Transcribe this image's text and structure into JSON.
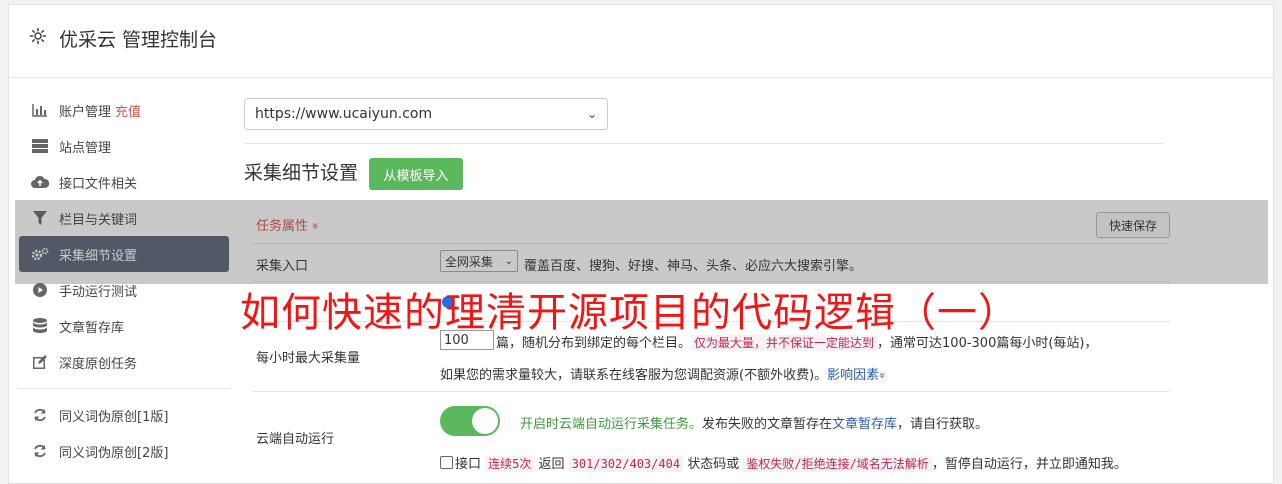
{
  "header": {
    "title": "优采云 管理控制台",
    "icon": "gear-icon"
  },
  "sidebar": {
    "items": [
      {
        "label": "账户管理",
        "badge": "充值",
        "icon": "bar-chart-icon"
      },
      {
        "label": "站点管理",
        "icon": "server-icon"
      },
      {
        "label": "接口文件相关",
        "icon": "cloud-upload-icon"
      },
      {
        "label": "栏目与关键词",
        "icon": "filter-icon"
      },
      {
        "label": "采集细节设置",
        "icon": "gears-icon",
        "active": true
      },
      {
        "label": "手动运行测试",
        "icon": "play-circle-icon"
      },
      {
        "label": "文章暂存库",
        "icon": "database-icon"
      },
      {
        "label": "深度原创任务",
        "icon": "edit-icon"
      },
      {
        "label": "同义词伪原创[1版]",
        "icon": "refresh-icon"
      },
      {
        "label": "同义词伪原创[2版]",
        "icon": "refresh-icon"
      }
    ]
  },
  "main": {
    "site_url": "https://www.ucaiyun.com",
    "section_title": "采集细节设置",
    "import_button": "从模板导入",
    "task_attr": "任务属性",
    "task_attr_chevron": "»",
    "quick_save": "快速保存",
    "collect_entry": {
      "label": "采集入口",
      "select_value": "全网采集",
      "desc": "覆盖百度、搜狗、好搜、神马、头条、必应六大搜索引擎。"
    },
    "hourly": {
      "label": "每小时最大采集量",
      "value": "100",
      "text1": "篇，随机分布到绑定的每个栏目。",
      "code1": "仅为最大量，并不保证一定能达到",
      "text2": "，通常可达100-300篇每小时(每站)，",
      "text3": "如果您的需求量较大，请联系在线客服为您调配资源(不额外收费)。",
      "link": "影响因素",
      "link_chevron": "»"
    },
    "cloud_run": {
      "label": "云端自动运行",
      "text_green": "开启时云端自动运行采集任务。",
      "text1": "发布失败的文章暂存在",
      "link": "文章暂存库",
      "text2": "，请自行获取。",
      "cb_label": "接口",
      "code1": "连续5次",
      "text3": "返回",
      "code2": "301/302/403/404",
      "text4": "状态码或",
      "code3": "鉴权失败/拒绝连接/域名无法解析",
      "text5": "，暂停自动运行，并立即通知我。"
    }
  },
  "watermark": "如何快速的理清开源项目的代码逻辑（一）"
}
